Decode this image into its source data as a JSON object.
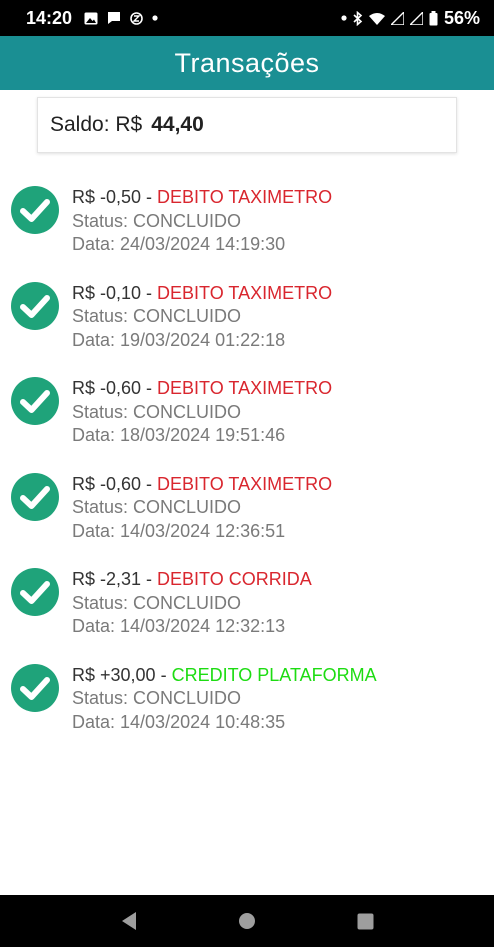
{
  "status_bar": {
    "time": "14:20",
    "battery": "56%",
    "icons_left": [
      "image-icon",
      "chat-bubble-icon",
      "z-app-icon",
      "dot-icon"
    ],
    "icons_right": [
      "dot-icon",
      "bluetooth-icon",
      "wifi-icon",
      "signal-icon",
      "signal-icon",
      "battery-icon"
    ]
  },
  "app_bar": {
    "title": "Transações"
  },
  "balance": {
    "label": "Saldo: R$",
    "amount": "44,40"
  },
  "transactions": [
    {
      "amount": "R$ -0,50",
      "sep": " - ",
      "description": "DEBITO TAXIMETRO",
      "type": "debit",
      "status": "Status: CONCLUIDO",
      "date": "Data: 24/03/2024 14:19:30"
    },
    {
      "amount": "R$ -0,10",
      "sep": " - ",
      "description": "DEBITO TAXIMETRO",
      "type": "debit",
      "status": "Status: CONCLUIDO",
      "date": "Data: 19/03/2024 01:22:18"
    },
    {
      "amount": "R$ -0,60",
      "sep": " - ",
      "description": "DEBITO TAXIMETRO",
      "type": "debit",
      "status": "Status: CONCLUIDO",
      "date": "Data: 18/03/2024 19:51:46"
    },
    {
      "amount": "R$ -0,60",
      "sep": " - ",
      "description": "DEBITO TAXIMETRO",
      "type": "debit",
      "status": "Status: CONCLUIDO",
      "date": "Data: 14/03/2024 12:36:51"
    },
    {
      "amount": "R$ -2,31",
      "sep": " - ",
      "description": "DEBITO CORRIDA",
      "type": "debit",
      "status": "Status: CONCLUIDO",
      "date": "Data: 14/03/2024 12:32:13"
    },
    {
      "amount": "R$ +30,00",
      "sep": " - ",
      "description": "CREDITO PLATAFORMA",
      "type": "credit",
      "status": "Status: CONCLUIDO",
      "date": "Data: 14/03/2024 10:48:35"
    }
  ],
  "nav_bar": {
    "buttons": [
      "back-icon",
      "home-icon",
      "recents-icon"
    ]
  },
  "colors": {
    "app_bar": "#1a8f93",
    "check": "#1fa37a",
    "debit": "#d9262e",
    "credit": "#1ddc12"
  }
}
